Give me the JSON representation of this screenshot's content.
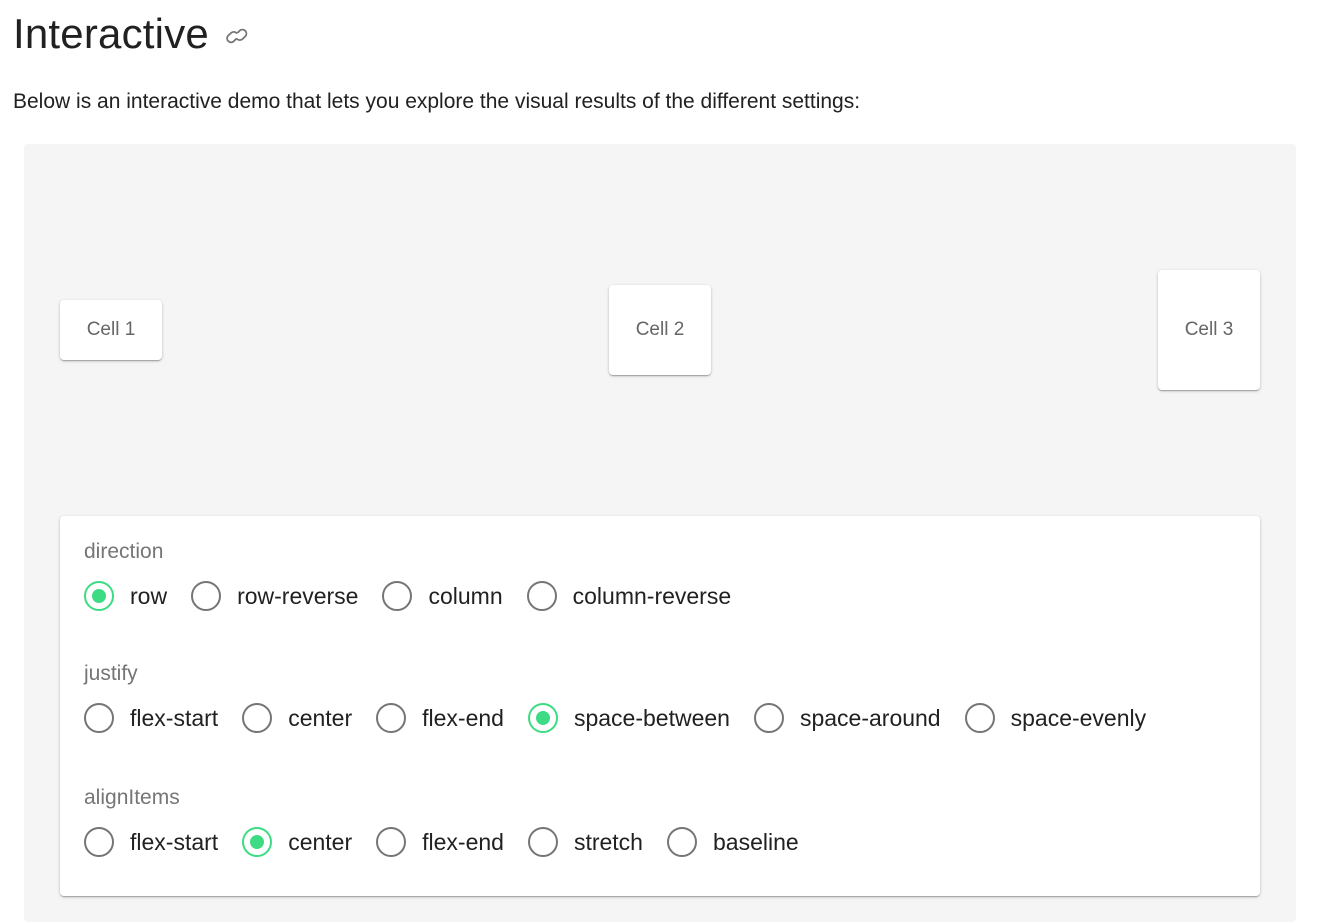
{
  "heading": {
    "title": "Interactive",
    "link_icon": "link-icon"
  },
  "intro": "Below is an interactive demo that lets you explore the visual results of the different settings:",
  "cells": [
    "Cell 1",
    "Cell 2",
    "Cell 3"
  ],
  "controls": {
    "direction": {
      "label": "direction",
      "selected": "row",
      "options": [
        "row",
        "row-reverse",
        "column",
        "column-reverse"
      ]
    },
    "justify": {
      "label": "justify",
      "selected": "space-between",
      "options": [
        "flex-start",
        "center",
        "flex-end",
        "space-between",
        "space-around",
        "space-evenly"
      ]
    },
    "alignItems": {
      "label": "alignItems",
      "selected": "center",
      "options": [
        "flex-start",
        "center",
        "flex-end",
        "stretch",
        "baseline"
      ]
    }
  },
  "colors": {
    "accent": "#3ddc84",
    "radio_unchecked": "#757575",
    "demo_background": "#f5f5f5"
  }
}
